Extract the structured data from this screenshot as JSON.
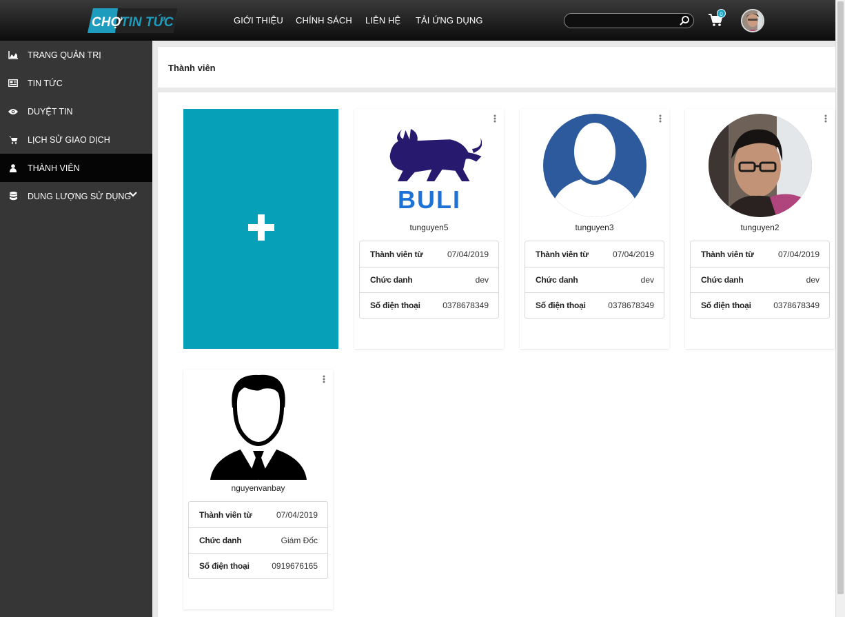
{
  "brand": {
    "logo_text": "CHỢ TIN TỨC",
    "accent": "#06a0b8"
  },
  "nav": [
    {
      "label": "GIỚI THIỆU"
    },
    {
      "label": "CHÍNH SÁCH"
    },
    {
      "label": "LIÊN HỆ"
    },
    {
      "label": "TẢI ỨNG DỤNG"
    }
  ],
  "search": {
    "placeholder": "",
    "value": ""
  },
  "cart": {
    "count": "0"
  },
  "sidebar": {
    "items": [
      {
        "label": "TRANG QUẢN TRỊ",
        "icon": "area-chart-icon"
      },
      {
        "label": "TIN TỨC",
        "icon": "newspaper-icon"
      },
      {
        "label": "DUYỆT TIN",
        "icon": "eye-icon"
      },
      {
        "label": "LỊCH SỬ GIAO DỊCH",
        "icon": "cart-icon"
      },
      {
        "label": "THÀNH VIÊN",
        "icon": "user-icon",
        "active": true
      },
      {
        "label": "DUNG LƯỢNG SỬ DỤNG",
        "icon": "database-icon"
      }
    ]
  },
  "page": {
    "title": "Thành viên"
  },
  "add_card": {
    "icon": "plus-icon"
  },
  "members": [
    {
      "username": "tunguyen5",
      "avatar": "buli-logo",
      "rows": [
        {
          "key": "Thành viên từ",
          "value": "07/04/2019"
        },
        {
          "key": "Chức danh",
          "value": "dev"
        },
        {
          "key": "Số điện thoại",
          "value": "0378678349"
        }
      ]
    },
    {
      "username": "tunguyen3",
      "avatar": "default-avatar",
      "rows": [
        {
          "key": "Thành viên từ",
          "value": "07/04/2019"
        },
        {
          "key": "Chức danh",
          "value": "dev"
        },
        {
          "key": "Số điện thoại",
          "value": "0378678349"
        }
      ]
    },
    {
      "username": "tunguyen2",
      "avatar": "photo-avatar",
      "rows": [
        {
          "key": "Thành viên từ",
          "value": "07/04/2019"
        },
        {
          "key": "Chức danh",
          "value": "dev"
        },
        {
          "key": "Số điện thoại",
          "value": "0378678349"
        }
      ]
    },
    {
      "username": "nguyenvanbay",
      "avatar": "businessman-avatar",
      "rows": [
        {
          "key": "Thành viên từ",
          "value": "07/04/2019"
        },
        {
          "key": "Chức danh",
          "value": "Giám Đốc"
        },
        {
          "key": "Số điện thoại",
          "value": "0919676165"
        }
      ]
    }
  ]
}
